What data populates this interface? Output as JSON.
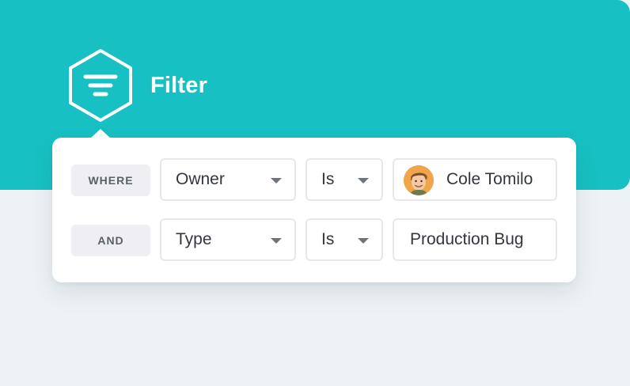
{
  "header": {
    "title": "Filter"
  },
  "rows": [
    {
      "connector": "WHERE",
      "field": "Owner",
      "operator": "Is",
      "value": "Cole Tomilo",
      "value_icon": "avatar"
    },
    {
      "connector": "AND",
      "field": "Type",
      "operator": "Is",
      "value": "Production Bug"
    }
  ],
  "icons": {
    "badge": "filter-icon",
    "dropdown": "chevron-down-icon"
  },
  "colors": {
    "accent": "#17c0c3",
    "background": "#edf2f5",
    "card": "#ffffff",
    "chip": "#efeff3",
    "text": "#33373d"
  }
}
